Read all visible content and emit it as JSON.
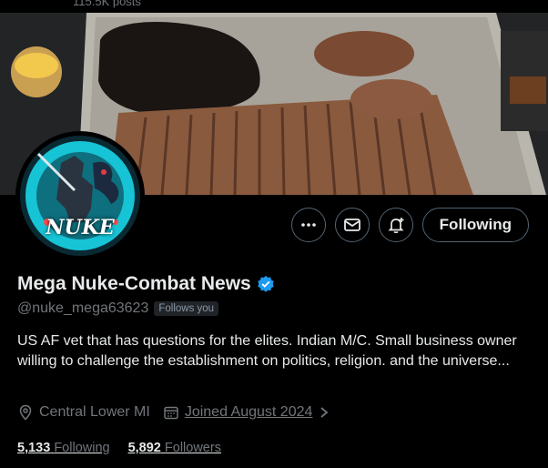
{
  "header": {
    "post_count": "115.5K posts"
  },
  "profile": {
    "display_name": "Mega Nuke-Combat News",
    "handle": "@nuke_mega63623",
    "follows_you_label": "Follows you",
    "avatar_text": "NUKE",
    "bio": "US AF vet that has questions for the elites.  Indian M/C. Small business owner willing to challenge the establishment on politics, religion. and the universe...",
    "location": "Central Lower MI",
    "joined": "Joined August 2024",
    "following_count": "5,133",
    "following_label": "Following",
    "followers_count": "5,892",
    "followers_label": "Followers"
  },
  "actions": {
    "follow_button_label": "Following",
    "more_icon": "more-icon",
    "message_icon": "mail-icon",
    "notify_icon": "bell-plus-icon"
  },
  "colors": {
    "background": "#000000",
    "text_primary": "#e7e9ea",
    "text_secondary": "#71767b",
    "verified_blue": "#1d9bf0",
    "border": "#536471"
  }
}
